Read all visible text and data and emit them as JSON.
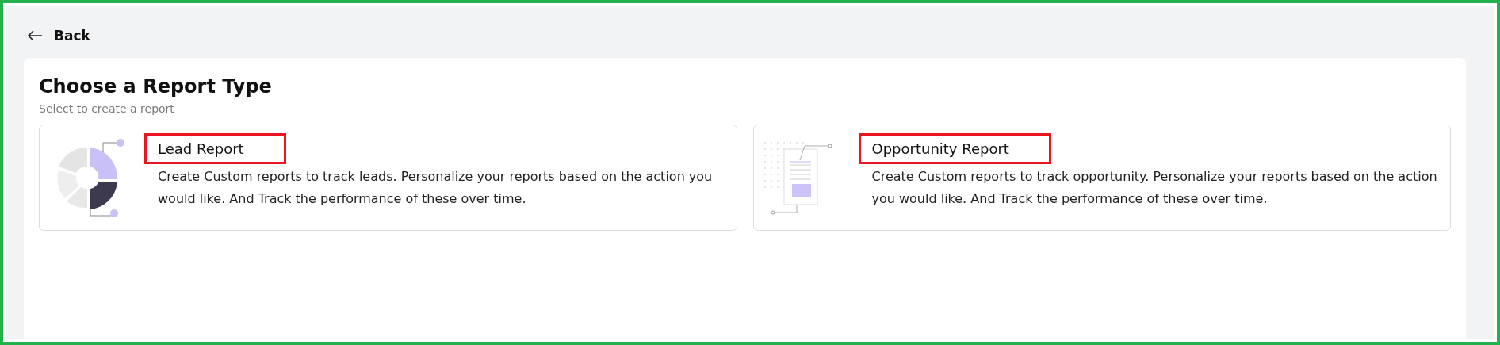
{
  "back": {
    "label": "Back"
  },
  "header": {
    "title": "Choose a Report Type",
    "subtitle": "Select to create a report"
  },
  "frame": {
    "highlighted": true
  },
  "report_types": [
    {
      "kind": "lead",
      "title": "Lead Report",
      "highlighted": true,
      "description": "Create Custom reports to track leads. Personalize your reports based on the action you would like. And Track the performance of these over time."
    },
    {
      "kind": "opportunity",
      "title": "Opportunity Report",
      "highlighted": true,
      "description": "Create Custom reports to track opportunity. Personalize your reports based on the action you would like. And Track the performance of these over time."
    }
  ]
}
